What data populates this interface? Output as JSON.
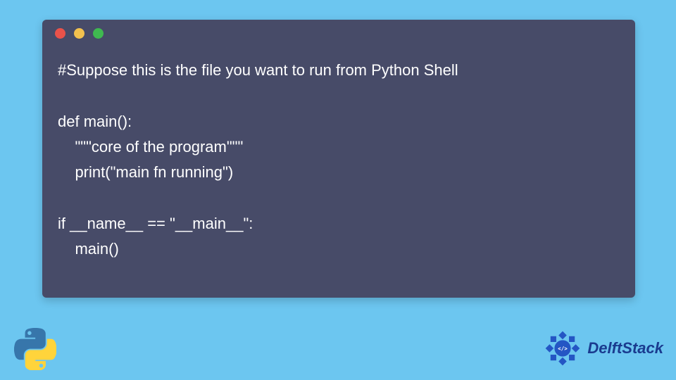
{
  "code": {
    "lines": [
      "#Suppose this is the file you want to run from Python Shell",
      "",
      "def main():",
      "    \"\"\"core of the program\"\"\"",
      "    print(\"main fn running\")",
      "",
      "if __name__ == \"__main__\":",
      "    main()"
    ],
    "text": "#Suppose this is the file you want to run from Python Shell\n\ndef main():\n    \"\"\"core of the program\"\"\"\n    print(\"main fn running\")\n\nif __name__ == \"__main__\":\n    main()"
  },
  "window": {
    "dots": [
      "red",
      "yellow",
      "green"
    ]
  },
  "branding": {
    "name": "DelftStack"
  },
  "colors": {
    "background": "#6cc6f0",
    "window_bg": "#474b68",
    "text": "#ffffff",
    "brand_text": "#1a3b8f"
  }
}
